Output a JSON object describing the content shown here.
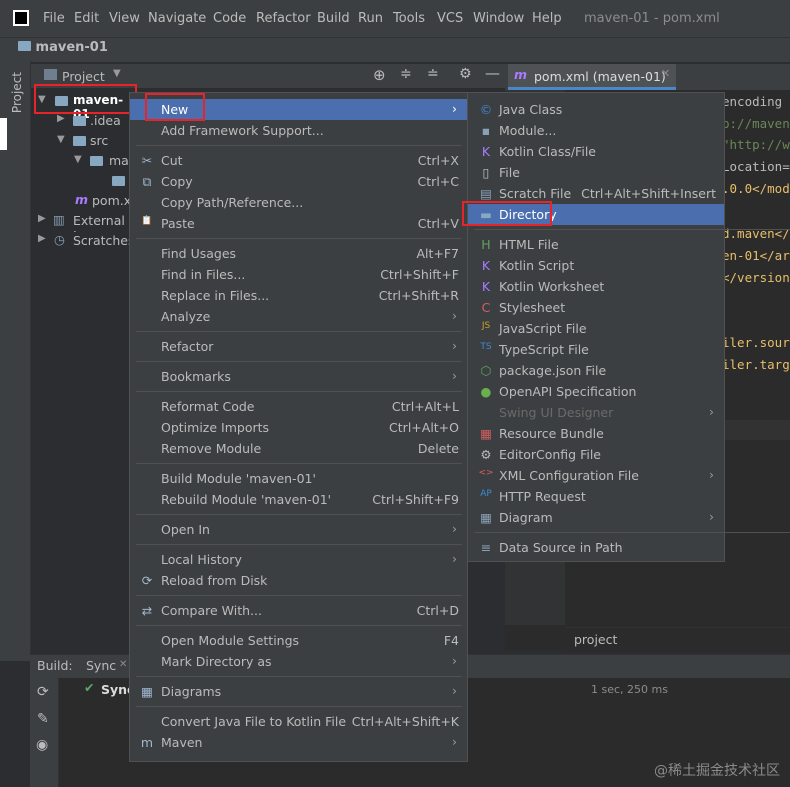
{
  "menubar": {
    "items": [
      "File",
      "Edit",
      "View",
      "Navigate",
      "Code",
      "Refactor",
      "Build",
      "Run",
      "Tools",
      "VCS",
      "Window",
      "Help"
    ],
    "window_title": "maven-01 - pom.xml"
  },
  "navbar": {
    "breadcrumb": "maven-01"
  },
  "tool_window": {
    "stripe_label": "Project",
    "header_label": "Project",
    "tree": [
      {
        "label": "maven-01",
        "icon": "module-folder-icon"
      },
      {
        "label": ".idea",
        "icon": "folder-icon"
      },
      {
        "label": "src",
        "icon": "folder-icon"
      },
      {
        "label": "mai",
        "icon": "folder-icon"
      },
      {
        "label": "pom.x",
        "icon": "maven-icon"
      },
      {
        "label": "External L",
        "icon": "library-icon"
      },
      {
        "label": "Scratches",
        "icon": "scratches-icon"
      }
    ]
  },
  "editor": {
    "tab_label": "pom.xml (maven-01)",
    "code_lines": [
      "encoding",
      "p://maven",
      "\"http://w",
      "Location=",
      ".0.0</mod",
      "",
      "d.maven</",
      "en-01</ar",
      "</version>",
      "",
      "",
      "iler.sour",
      "iler.targ"
    ],
    "footer": "project"
  },
  "build": {
    "label": "Build:",
    "tab": "Sync",
    "row_label": "Sync",
    "time": "1 sec, 250 ms"
  },
  "context_menu": [
    {
      "label": "New",
      "arrow": true,
      "selected": true
    },
    {
      "label": "Add Framework Support..."
    },
    {
      "sep": true
    },
    {
      "label": "Cut",
      "shortcut": "Ctrl+X",
      "icon": "✂",
      "icon_name": "cut-icon"
    },
    {
      "label": "Copy",
      "shortcut": "Ctrl+C",
      "icon": "⧉",
      "icon_name": "copy-icon"
    },
    {
      "label": "Copy Path/Reference..."
    },
    {
      "label": "Paste",
      "shortcut": "Ctrl+V",
      "icon": "📋",
      "icon_name": "paste-icon"
    },
    {
      "sep": true
    },
    {
      "label": "Find Usages",
      "shortcut": "Alt+F7"
    },
    {
      "label": "Find in Files...",
      "shortcut": "Ctrl+Shift+F"
    },
    {
      "label": "Replace in Files...",
      "shortcut": "Ctrl+Shift+R"
    },
    {
      "label": "Analyze",
      "arrow": true
    },
    {
      "sep": true
    },
    {
      "label": "Refactor",
      "arrow": true
    },
    {
      "sep": true
    },
    {
      "label": "Bookmarks",
      "arrow": true
    },
    {
      "sep": true
    },
    {
      "label": "Reformat Code",
      "shortcut": "Ctrl+Alt+L"
    },
    {
      "label": "Optimize Imports",
      "shortcut": "Ctrl+Alt+O"
    },
    {
      "label": "Remove Module",
      "shortcut": "Delete"
    },
    {
      "sep": true
    },
    {
      "label": "Build Module 'maven-01'"
    },
    {
      "label": "Rebuild Module 'maven-01'",
      "shortcut": "Ctrl+Shift+F9"
    },
    {
      "sep": true
    },
    {
      "label": "Open In",
      "arrow": true
    },
    {
      "sep": true
    },
    {
      "label": "Local History",
      "arrow": true
    },
    {
      "label": "Reload from Disk",
      "icon": "⟳",
      "icon_name": "reload-icon"
    },
    {
      "sep": true
    },
    {
      "label": "Compare With...",
      "shortcut": "Ctrl+D",
      "icon": "⇄",
      "icon_name": "compare-icon"
    },
    {
      "sep": true
    },
    {
      "label": "Open Module Settings",
      "shortcut": "F4"
    },
    {
      "label": "Mark Directory as",
      "arrow": true
    },
    {
      "sep": true
    },
    {
      "label": "Diagrams",
      "arrow": true,
      "icon": "▦",
      "icon_name": "diagrams-icon"
    },
    {
      "sep": true
    },
    {
      "label": "Convert Java File to Kotlin File",
      "shortcut": "Ctrl+Alt+Shift+K"
    },
    {
      "label": "Maven",
      "arrow": true,
      "icon": "m",
      "icon_name": "maven-icon"
    }
  ],
  "submenu": [
    {
      "label": "Java Class",
      "icon": "©",
      "icon_name": "java-class-icon",
      "color": "#3d8bd4"
    },
    {
      "label": "Module...",
      "icon": "▪",
      "icon_name": "module-icon",
      "color": "#8aa0b8"
    },
    {
      "label": "Kotlin Class/File",
      "icon": "K",
      "icon_name": "kotlin-icon",
      "color": "#a97bff"
    },
    {
      "label": "File",
      "icon": "▯",
      "icon_name": "file-icon",
      "color": "#c0c0c0"
    },
    {
      "label": "Scratch File",
      "shortcut": "Ctrl+Alt+Shift+Insert",
      "icon": "▤",
      "icon_name": "scratch-file-icon",
      "color": "#8aa0b8"
    },
    {
      "label": "Directory",
      "icon": "▬",
      "icon_name": "directory-icon",
      "color": "#88a8c2",
      "selected": true
    },
    {
      "sep": true
    },
    {
      "label": "HTML File",
      "icon": "H",
      "icon_name": "html-file-icon",
      "color": "#5fa35f"
    },
    {
      "label": "Kotlin Script",
      "icon": "K",
      "icon_name": "kotlin-script-icon",
      "color": "#a97bff"
    },
    {
      "label": "Kotlin Worksheet",
      "icon": "K",
      "icon_name": "kotlin-worksheet-icon",
      "color": "#a97bff"
    },
    {
      "label": "Stylesheet",
      "icon": "C",
      "icon_name": "stylesheet-icon",
      "color": "#d35f5f"
    },
    {
      "label": "JavaScript File",
      "icon": "JS",
      "icon_name": "javascript-file-icon",
      "color": "#c9a227"
    },
    {
      "label": "TypeScript File",
      "icon": "TS",
      "icon_name": "typescript-file-icon",
      "color": "#3d8bd4"
    },
    {
      "label": "package.json File",
      "icon": "⬡",
      "icon_name": "package-json-icon",
      "color": "#5fa35f"
    },
    {
      "label": "OpenAPI Specification",
      "icon": "●",
      "icon_name": "openapi-icon",
      "color": "#6ab04c"
    },
    {
      "label": "Swing UI Designer",
      "arrow": true,
      "disabled": true
    },
    {
      "label": "Resource Bundle",
      "icon": "▦",
      "icon_name": "resource-bundle-icon",
      "color": "#d35f5f"
    },
    {
      "label": "EditorConfig File",
      "icon": "⚙",
      "icon_name": "editorconfig-icon",
      "color": "#bbbbbb"
    },
    {
      "label": "XML Configuration File",
      "arrow": true,
      "icon": "<>",
      "icon_name": "xml-config-icon",
      "color": "#d35f5f"
    },
    {
      "label": "HTTP Request",
      "icon": "AP",
      "icon_name": "http-request-icon",
      "color": "#3d8bd4"
    },
    {
      "label": "Diagram",
      "arrow": true,
      "icon": "▦",
      "icon_name": "diagram-icon",
      "color": "#8aa0b8"
    },
    {
      "sep": true
    },
    {
      "label": "Data Source in Path",
      "icon": "≡",
      "icon_name": "data-source-icon",
      "color": "#8aa0b8"
    }
  ],
  "watermark": "@稀土掘金技术社区",
  "colors": {
    "selection": "#4b6eaf",
    "menu_bg": "#3c3f41",
    "highlight_box": "#e8232a",
    "editor_bg": "#2b2b2b"
  }
}
